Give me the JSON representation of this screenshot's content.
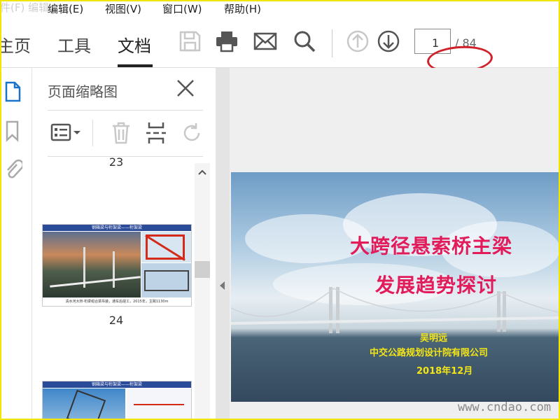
{
  "watermark_top": "件(F) 编辑",
  "menu": [
    {
      "label": "编辑(E)"
    },
    {
      "label": "视图(V)"
    },
    {
      "label": "窗口(W)"
    },
    {
      "label": "帮助(H)"
    }
  ],
  "tabs": [
    {
      "label": "主页"
    },
    {
      "label": "工具"
    },
    {
      "label": "文档"
    }
  ],
  "page_nav": {
    "current": "1",
    "total_label": "/ 84"
  },
  "thumbnail_panel": {
    "title": "页面缩略图",
    "page_prev": "23",
    "page_current": "24",
    "thumb_header": "钢箱梁与桁架梁——桁架梁",
    "thumb_caption": "清水河大桥·桁梁组合梁吊装，通车后竣工，2015年，主跨1130m"
  },
  "slide": {
    "title_line1": "大跨径悬索桥主梁",
    "title_line2": "发展趋势探讨",
    "author": "吴明远",
    "organization": "中交公路规划设计院有限公司",
    "date": "2018年12月"
  },
  "site_watermark": "www.cndao.com",
  "colors": {
    "accent_red": "#d0202a",
    "slide_title": "#e21b5a",
    "slide_text": "#f4e516",
    "frame": "#f2e600"
  }
}
